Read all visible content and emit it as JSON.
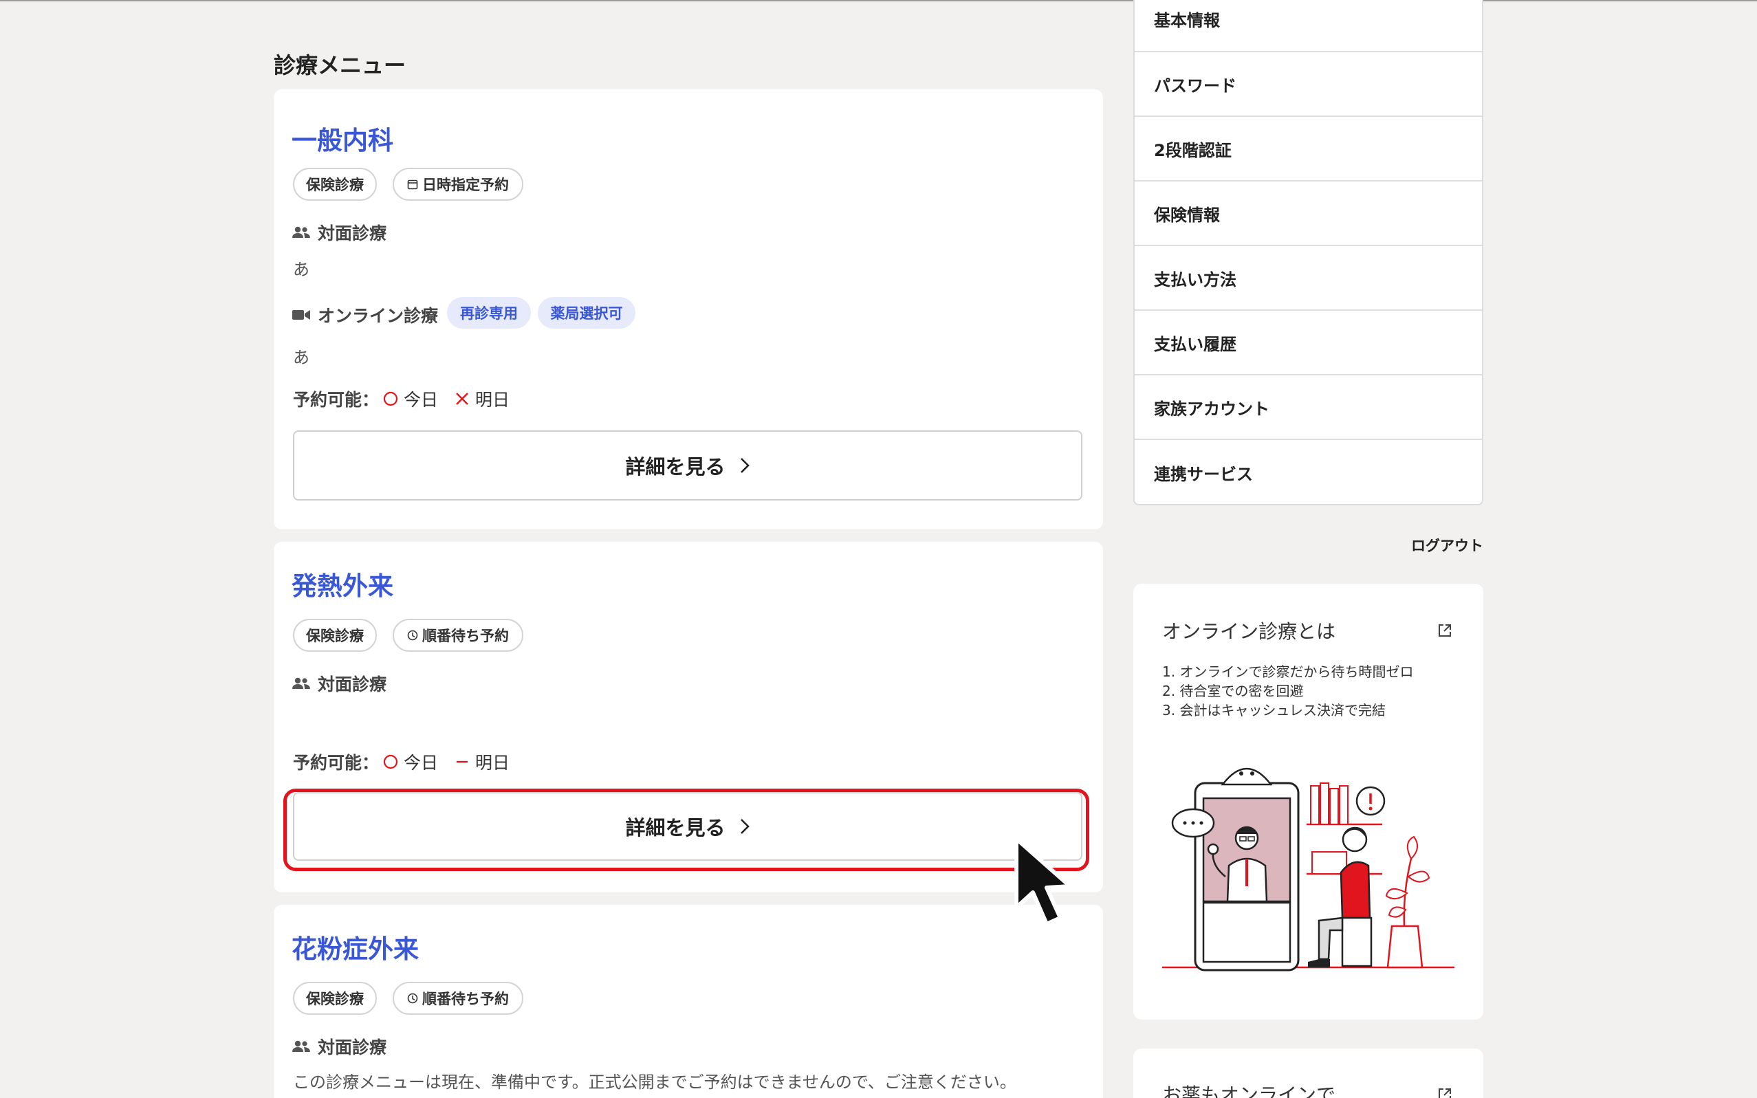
{
  "section_title": "診療メニュー",
  "cards": [
    {
      "title": "一般内科",
      "tags": [
        "保険診療",
        "日時指定予約"
      ],
      "in_person_label": "対面診療",
      "in_person_desc": "あ",
      "online_label": "オンライン診療",
      "online_chips": [
        "再診専用",
        "薬局選択可"
      ],
      "online_desc": "あ",
      "availability_label": "予約可能：",
      "today": "今日",
      "tomorrow": "明日",
      "today_status": "available",
      "tomorrow_status": "unavailable",
      "detail_button": "詳細を見る"
    },
    {
      "title": "発熱外来",
      "tags": [
        "保険診療",
        "順番待ち予約"
      ],
      "in_person_label": "対面診療",
      "availability_label": "予約可能：",
      "today": "今日",
      "tomorrow": "明日",
      "today_status": "available",
      "tomorrow_status": "none",
      "detail_button": "詳細を見る"
    },
    {
      "title": "花粉症外来",
      "tags": [
        "保険診療",
        "順番待ち予約"
      ],
      "in_person_label": "対面診療",
      "notice": "この診療メニューは現在、準備中です。正式公開までご予約はできませんので、ご注意ください。"
    }
  ],
  "sidebar": {
    "menu": [
      "基本情報",
      "パスワード",
      "2段階認証",
      "保険情報",
      "支払い方法",
      "支払い履歴",
      "家族アカウント",
      "連携サービス"
    ],
    "logout": "ログアウト",
    "info_title": "オンライン診療とは",
    "info_points": [
      "1. オンラインで診察だから待ち時間ゼロ",
      "2. 待合室での密を回避",
      "3. 会計はキャッシュレス決済で完結"
    ],
    "info2_title": "お薬もオンラインで"
  },
  "colors": {
    "accent": "#3a57d6",
    "highlight": "#e0151e",
    "background": "#f2f1f0",
    "chip_bg": "#e6eafb"
  }
}
